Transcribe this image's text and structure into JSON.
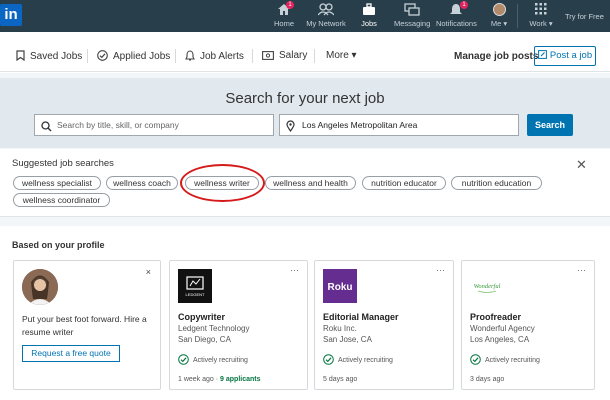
{
  "topnav": {
    "logo": "in",
    "items": [
      {
        "label": "Home",
        "icon": "home-icon",
        "badge": "1"
      },
      {
        "label": "My Network",
        "icon": "network-icon"
      },
      {
        "label": "Jobs",
        "icon": "briefcase-icon"
      },
      {
        "label": "Messaging",
        "icon": "messaging-icon"
      },
      {
        "label": "Notifications",
        "icon": "bell-icon",
        "badge": "1"
      },
      {
        "label": "Me ▾",
        "icon": "avatar"
      },
      {
        "label": "Work ▾",
        "icon": "grid-icon"
      }
    ],
    "try_free": "Try for Free"
  },
  "subnav": {
    "saved_jobs": "Saved Jobs",
    "applied_jobs": "Applied Jobs",
    "job_alerts": "Job Alerts",
    "salary": "Salary",
    "more": "More ▾",
    "manage": "Manage job posts",
    "post_job": "Post a job"
  },
  "search": {
    "title": "Search for your next job",
    "keyword_placeholder": "Search by title, skill, or company",
    "location_value": "Los Angeles Metropolitan Area",
    "button": "Search"
  },
  "suggested": {
    "title": "Suggested job searches",
    "pills": [
      "wellness specialist",
      "wellness coach",
      "wellness writer",
      "wellness and health",
      "nutrition educator",
      "nutrition education",
      "wellness coordinator"
    ]
  },
  "profile": {
    "title": "Based on your profile",
    "promo": {
      "text": "Put your best foot forward. Hire a resume writer",
      "button": "Request a free quote",
      "close": "×"
    },
    "jobs": [
      {
        "title": "Copywriter",
        "company": "Ledgent Technology",
        "location": "San Diego, CA",
        "status": "Actively recruiting",
        "time": "1 week ago · ",
        "applicants": "9 applicants",
        "logo": "LEDGENT"
      },
      {
        "title": "Editorial Manager",
        "company": "Roku Inc.",
        "location": "San Jose, CA",
        "status": "Actively recruiting",
        "time": "5 days ago",
        "applicants": "",
        "logo": "Roku"
      },
      {
        "title": "Proofreader",
        "company": "Wonderful Agency",
        "location": "Los Angeles, CA",
        "status": "Actively recruiting",
        "time": "3 days ago",
        "applicants": "",
        "logo": "Wonderful"
      }
    ],
    "more": "···"
  },
  "colors": {
    "nav_bg": "#283e4a",
    "brand_blue": "#0073b1",
    "highlight_red": "#d61a1a",
    "recruit_green": "#057642"
  }
}
